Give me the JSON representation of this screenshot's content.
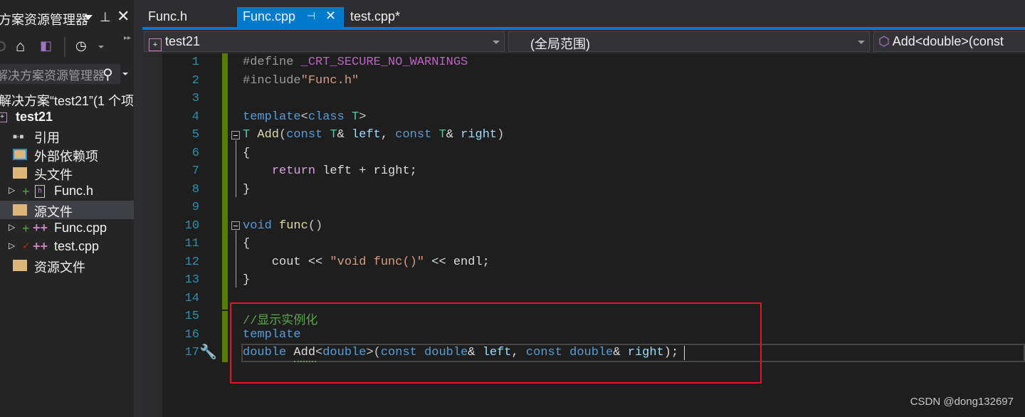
{
  "sidebar": {
    "title": "方案资源管理器",
    "search_placeholder": "解决方案资源管理器",
    "items": [
      {
        "label": "解决方案“test21”(1 个项",
        "icon": "none"
      },
      {
        "label": "test21",
        "icon": "cpp-project-icon"
      },
      {
        "label": "引用",
        "icon": "references-icon"
      },
      {
        "label": "外部依赖项",
        "icon": "external-deps-icon"
      },
      {
        "label": "头文件",
        "icon": "filter-folder-icon"
      },
      {
        "label": "Func.h",
        "icon": "header-file-icon",
        "status": "added"
      },
      {
        "label": "源文件",
        "icon": "filter-folder-icon",
        "selected": true
      },
      {
        "label": "Func.cpp",
        "icon": "cpp-file-icon",
        "status": "added"
      },
      {
        "label": "test.cpp",
        "icon": "cpp-file-icon",
        "status": "modified"
      },
      {
        "label": "资源文件",
        "icon": "filter-folder-icon"
      }
    ]
  },
  "tabs": [
    {
      "label": "Func.h"
    },
    {
      "label": "Func.cpp",
      "active": true
    },
    {
      "label": "test.cpp*"
    }
  ],
  "nav": {
    "project": "test21",
    "scope": "(全局范围)",
    "member": "Add<double>(const"
  },
  "editor": {
    "lines": [
      [
        [
          "#define ",
          "pp"
        ],
        [
          "_CRT_SECURE_NO_WARNINGS",
          "mac"
        ]
      ],
      [
        [
          "#include",
          "pp"
        ],
        [
          "″Func.h″",
          "str"
        ]
      ],
      [],
      [
        [
          "template",
          "kw"
        ],
        [
          "<",
          "par"
        ],
        [
          "class ",
          "kw"
        ],
        [
          "T",
          "ty"
        ],
        [
          ">",
          "par"
        ]
      ],
      [
        [
          "T ",
          "ty"
        ],
        [
          "Add",
          "fn"
        ],
        [
          "(",
          "par"
        ],
        [
          "const ",
          "kw"
        ],
        [
          "T",
          "ty"
        ],
        [
          "& ",
          "plain"
        ],
        [
          "left",
          "id"
        ],
        [
          ", ",
          "plain"
        ],
        [
          "const ",
          "kw"
        ],
        [
          "T",
          "ty"
        ],
        [
          "& ",
          "plain"
        ],
        [
          "right",
          "id"
        ],
        [
          ")",
          "par"
        ]
      ],
      [
        [
          "{",
          "plain"
        ]
      ],
      [
        [
          "    ",
          "plain"
        ],
        [
          "return ",
          "ctl"
        ],
        [
          "left + right;",
          "plain"
        ]
      ],
      [
        [
          "}",
          "plain"
        ]
      ],
      [],
      [
        [
          "void ",
          "kw"
        ],
        [
          "func",
          "fn"
        ],
        [
          "()",
          "par"
        ]
      ],
      [
        [
          "{",
          "plain"
        ]
      ],
      [
        [
          "    cout << ",
          "plain"
        ],
        [
          "″void func()″",
          "str"
        ],
        [
          " << endl;",
          "plain"
        ]
      ],
      [
        [
          "}",
          "plain"
        ]
      ],
      [],
      [
        [
          "//显示实例化",
          "cm"
        ]
      ],
      [
        [
          "template",
          "kw"
        ]
      ],
      [
        [
          "double ",
          "kw"
        ],
        [
          "Add",
          "plain"
        ],
        [
          "<",
          "par"
        ],
        [
          "double",
          "kw"
        ],
        [
          ">(",
          "par"
        ],
        [
          "const ",
          "kw"
        ],
        [
          "double",
          "kw"
        ],
        [
          "& ",
          "plain"
        ],
        [
          "left",
          "id"
        ],
        [
          ", ",
          "plain"
        ],
        [
          "const ",
          "kw"
        ],
        [
          "double",
          "kw"
        ],
        [
          "& ",
          "plain"
        ],
        [
          "right",
          "id"
        ],
        [
          ");",
          "plain"
        ]
      ]
    ]
  },
  "watermark": "CSDN @dong132697",
  "colors": {
    "accent": "#007acc",
    "highlight_box": "#e81123",
    "change_bar": "#587c0c"
  }
}
